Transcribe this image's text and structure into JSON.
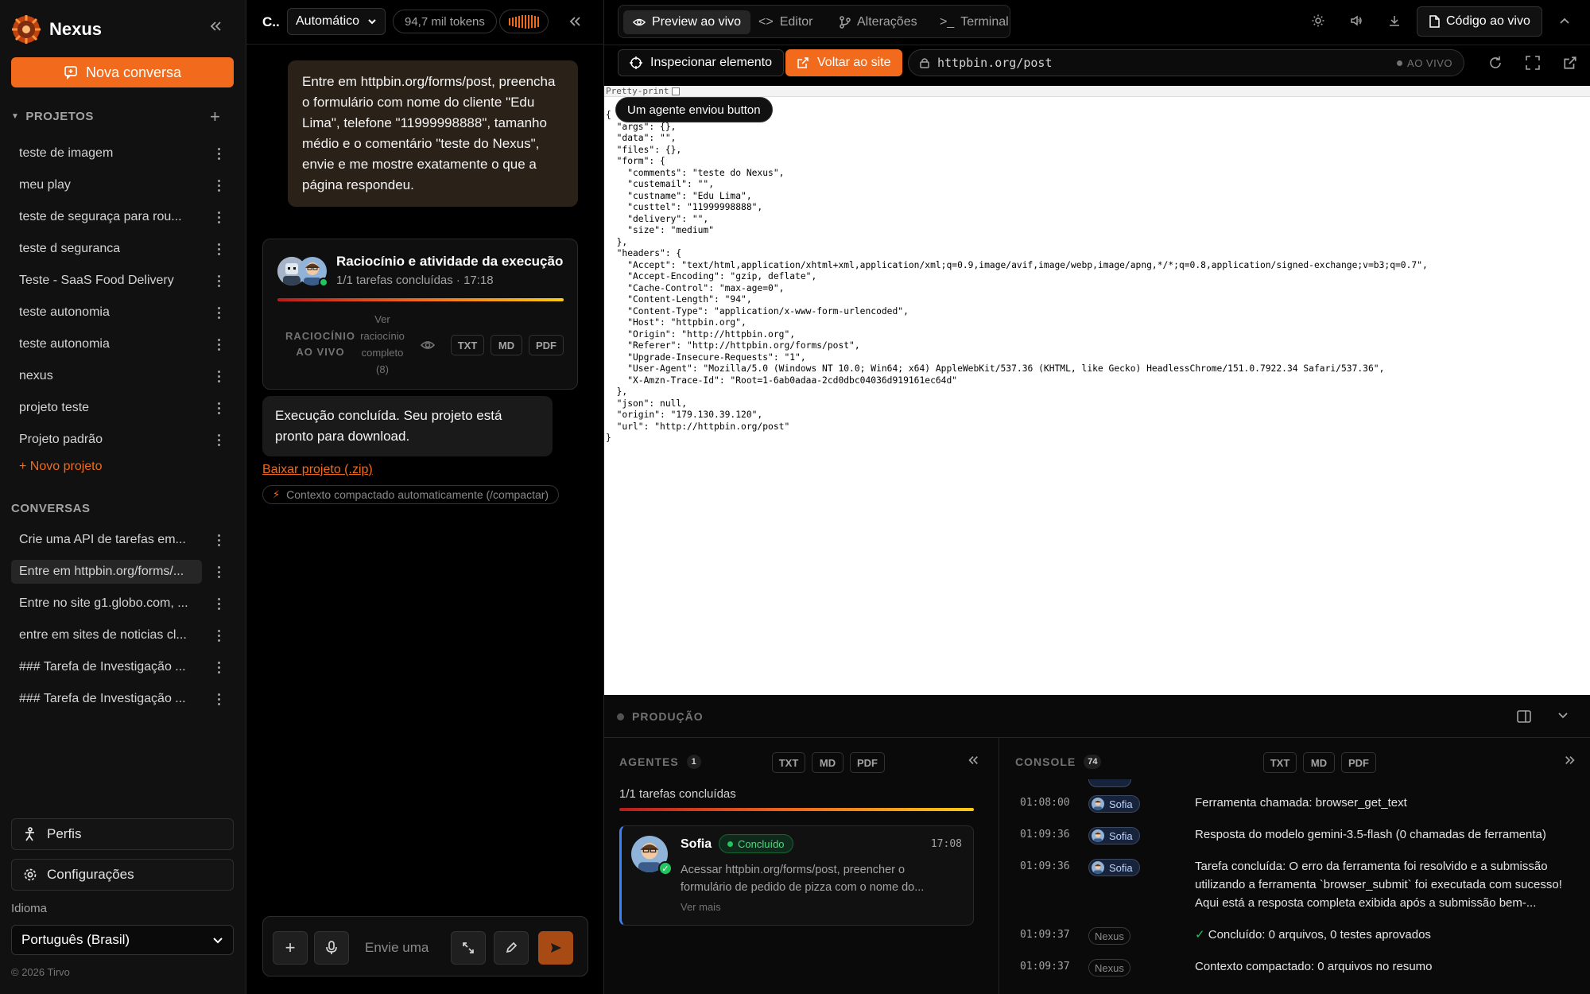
{
  "sidebar": {
    "brand": "Nexus",
    "new_chat": "Nova conversa",
    "projects_title": "PROJETOS",
    "projects": [
      "teste de imagem",
      "meu play",
      "teste de seguraça para rou...",
      "teste d seguranca",
      "Teste - SaaS Food Delivery",
      "teste autonomia",
      "teste autonomia",
      "nexus",
      "projeto teste",
      "Projeto padrão"
    ],
    "new_project": "+ Novo projeto",
    "conversations_title": "CONVERSAS",
    "conversations": [
      "Crie uma API de tarefas em...",
      "Entre em httpbin.org/forms/...",
      "Entre no site g1.globo.com, ...",
      "entre em sites de noticias cl...",
      "### Tarefa de Investigação ...",
      "### Tarefa de Investigação ..."
    ],
    "active_conversation": 1,
    "profiles": "Perfis",
    "settings": "Configurações",
    "language_label": "Idioma",
    "language_value": "Português (Brasil)",
    "copyright": "© 2026 Tirvo"
  },
  "chat": {
    "title": "C..",
    "model": "Automático",
    "tokens": "94,7 mil tokens",
    "user_message": "Entre em httpbin.org/forms/post, preencha o formulário com nome do cliente \"Edu Lima\", telefone \"11999998888\", tamanho médio e o comentário \"teste do Nexus\", envie e me mostre exatamente o que a página respondeu.",
    "activity": {
      "title": "Raciocínio e atividade da execução",
      "subtitle": "1/1 tarefas concluídas · 17:18",
      "progress": 1.0,
      "live_reasoning": "RACIOCÍNIO AO VIVO",
      "see_full": "Ver raciocínio completo (8)",
      "exports": [
        "TXT",
        "MD",
        "PDF"
      ]
    },
    "bot_message": "Execução concluída. Seu projeto está pronto para download.",
    "download_link": "Baixar projeto (.zip)",
    "context_note": "Contexto compactado automaticamente (/compactar)",
    "composer_placeholder": "Envie uma"
  },
  "preview": {
    "tabs": [
      "Preview ao vivo",
      "Editor",
      "Alterações",
      "Terminal"
    ],
    "active_tab": 0,
    "code_live": "Código ao vivo",
    "inspect": "Inspecionar elemento",
    "back_to_site": "Voltar ao site",
    "url": "httpbin.org/post",
    "live_badge": "AO VIVO",
    "pretty_print": "Pretty-print",
    "tooltip": "Um agente enviou button",
    "response_lines": [
      "{",
      "  \"args\": {},",
      "  \"data\": \"\",",
      "  \"files\": {},",
      "  \"form\": {",
      "    \"comments\": \"teste do Nexus\",",
      "    \"custemail\": \"\",",
      "    \"custname\": \"Edu Lima\",",
      "    \"custtel\": \"11999998888\",",
      "    \"delivery\": \"\",",
      "    \"size\": \"medium\"",
      "  },",
      "  \"headers\": {",
      "    \"Accept\": \"text/html,application/xhtml+xml,application/xml;q=0.9,image/avif,image/webp,image/apng,*/*;q=0.8,application/signed-exchange;v=b3;q=0.7\",",
      "    \"Accept-Encoding\": \"gzip, deflate\",",
      "    \"Cache-Control\": \"max-age=0\",",
      "    \"Content-Length\": \"94\",",
      "    \"Content-Type\": \"application/x-www-form-urlencoded\",",
      "    \"Host\": \"httpbin.org\",",
      "    \"Origin\": \"http://httpbin.org\",",
      "    \"Referer\": \"http://httpbin.org/forms/post\",",
      "    \"Upgrade-Insecure-Requests\": \"1\",",
      "    \"User-Agent\": \"Mozilla/5.0 (Windows NT 10.0; Win64; x64) AppleWebKit/537.36 (KHTML, like Gecko) HeadlessChrome/151.0.7922.34 Safari/537.36\",",
      "    \"X-Amzn-Trace-Id\": \"Root=1-6ab0adaa-2cd0dbc04036d919161ec64d\"",
      "  },",
      "  \"json\": null,",
      "  \"origin\": \"179.130.39.120\",",
      "  \"url\": \"http://httpbin.org/post\"",
      "}"
    ]
  },
  "production": {
    "label": "PRODUÇÃO",
    "agents": {
      "title": "AGENTES",
      "count": "1",
      "exports": [
        "TXT",
        "MD",
        "PDF"
      ],
      "tasks_done": "1/1 tarefas concluídas",
      "progress": 1.0,
      "card": {
        "name": "Sofia",
        "status": "Concluído",
        "time": "17:08",
        "description": "Acessar httpbin.org/forms/post, preencher o formulário de pedido de pizza com o nome do...",
        "more": "Ver mais"
      }
    },
    "console": {
      "title": "CONSOLE",
      "count": "74",
      "exports": [
        "TXT",
        "MD",
        "PDF"
      ],
      "logs": [
        {
          "time": "01:08:00",
          "agent": "Sofia",
          "message": "Ferramenta chamada: browser_get_text"
        },
        {
          "time": "01:09:36",
          "agent": "Sofia",
          "message": "Resposta do modelo gemini-3.5-flash (0 chamadas de ferramenta)"
        },
        {
          "time": "01:09:36",
          "agent": "Sofia",
          "message": "Tarefa concluída: O erro da ferramenta foi resolvido e a submissão utilizando a ferramenta `browser_submit` foi executada com sucesso! Aqui está a resposta completa exibida após a submissão bem-..."
        },
        {
          "time": "01:09:37",
          "agent": "Nexus",
          "message": "✓ Concluído: 0 arquivos, 0 testes aprovados"
        },
        {
          "time": "01:09:37",
          "agent": "Nexus",
          "message": "Contexto compactado: 0 arquivos no resumo"
        }
      ]
    }
  },
  "colors": {
    "accent": "#f26a1b",
    "success": "#22c55e",
    "agent_blue": "#3b82f6"
  }
}
